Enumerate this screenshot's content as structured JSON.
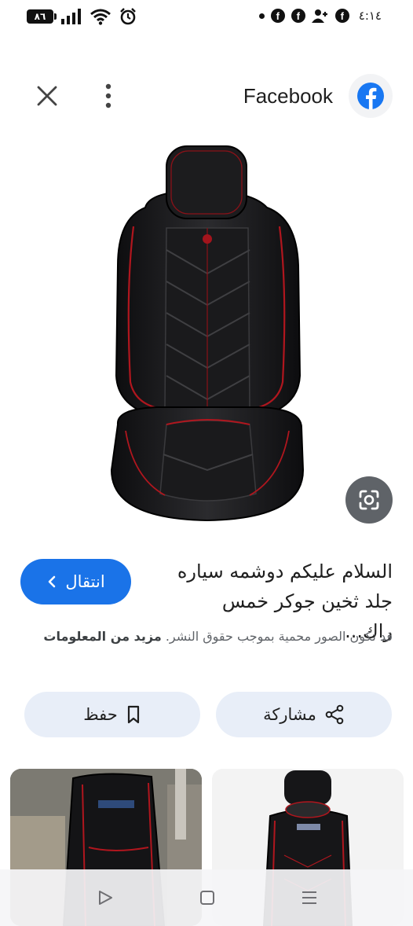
{
  "status_bar": {
    "battery": "٨٦",
    "time": "٤:١٤",
    "notification_icons": [
      "facebook-icon",
      "facebook-icon",
      "messenger-icon",
      "facebook-icon"
    ]
  },
  "header": {
    "site_name": "Facebook",
    "close_icon": "close-icon",
    "more_icon": "more-vertical-icon"
  },
  "result": {
    "title": "السلام عليكم دوشمه سياره جلد ثخين جوكر خمس راك...",
    "visit_label": "انتقال",
    "copyright_text": "قد تكون الصور محمية بموجب حقوق النشر.",
    "learn_more": "مزيد من المعلومات"
  },
  "actions": {
    "share_label": "مشاركة",
    "save_label": "حفظ"
  },
  "colors": {
    "accent": "#1a73e8",
    "facebook_blue": "#1877f2",
    "chip_bg": "#e8eef8",
    "lens_bg": "#5f6368"
  }
}
